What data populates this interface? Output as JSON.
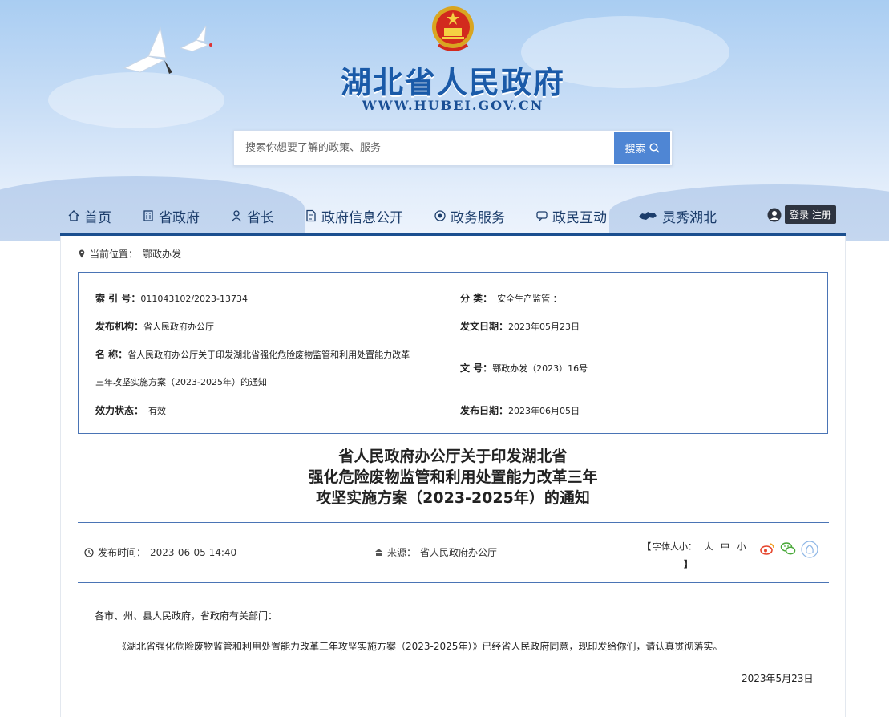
{
  "header": {
    "site_title": "湖北省人民政府",
    "site_url": "WWW.HUBEI.GOV.CN",
    "search": {
      "placeholder": "搜索你想要了解的政策、服务",
      "button_label": "搜索"
    }
  },
  "nav": {
    "items": [
      {
        "label": "首页",
        "icon": "home-icon"
      },
      {
        "label": "省政府",
        "icon": "building-icon"
      },
      {
        "label": "省长",
        "icon": "person-icon"
      },
      {
        "label": "政府信息公开",
        "icon": "document-icon"
      },
      {
        "label": "政务服务",
        "icon": "service-icon"
      },
      {
        "label": "政民互动",
        "icon": "chat-icon"
      },
      {
        "label": "灵秀湖北",
        "icon": "hubei-map-icon"
      }
    ],
    "login_label": "登录",
    "register_label": "注册"
  },
  "breadcrumb": {
    "prefix": "当前位置：",
    "current": "鄂政办发"
  },
  "meta": {
    "index_label": "索 引 号：",
    "index_value": "011043102/2023-13734",
    "category_label": "分 类：",
    "category_value": "安全生产监管    ：",
    "issuer_label": "发布机构：",
    "issuer_value": "省人民政府办公厅",
    "issue_date_label": "发文日期：",
    "issue_date_value": "2023年05月23日",
    "name_label": "名 称：",
    "name_value_line1": "省人民政府办公厅关于印发湖北省强化危险废物监管和利用处置能力改革",
    "name_value_line2": "三年攻坚实施方案（2023-2025年）的通知",
    "doc_no_label": "文 号：",
    "doc_no_value": "鄂政办发（2023）16号",
    "status_label": "效力状态：",
    "status_value": "有效",
    "publish_date_label": "发布日期：",
    "publish_date_value": "2023年06月05日"
  },
  "document": {
    "title_line1": "省人民政府办公厅关于印发湖北省",
    "title_line2": "强化危险废物监管和利用处置能力改革三年",
    "title_line3": "攻坚实施方案（2023-2025年）的通知",
    "publish_time_label": "发布时间：",
    "publish_time_value": "2023-06-05 14:40",
    "source_label": "来源：",
    "source_value": "省人民政府办公厅",
    "font_size_label": "字体大小：",
    "font_large": "大",
    "font_medium": "中",
    "font_small": "小",
    "recipients": "各市、州、县人民政府，省政府有关部门：",
    "paragraph1": "《湖北省强化危险废物监管和利用处置能力改革三年攻坚实施方案（2023-2025年）》已经省人民政府同意，现印发给你们，请认真贯彻落实。",
    "date_signature": "2023年5月23日"
  },
  "colors": {
    "brand_blue": "#1a5aa8",
    "nav_bar": "#1b4f8f",
    "frame_border": "#4a74b5",
    "search_button": "#4f86d4"
  }
}
